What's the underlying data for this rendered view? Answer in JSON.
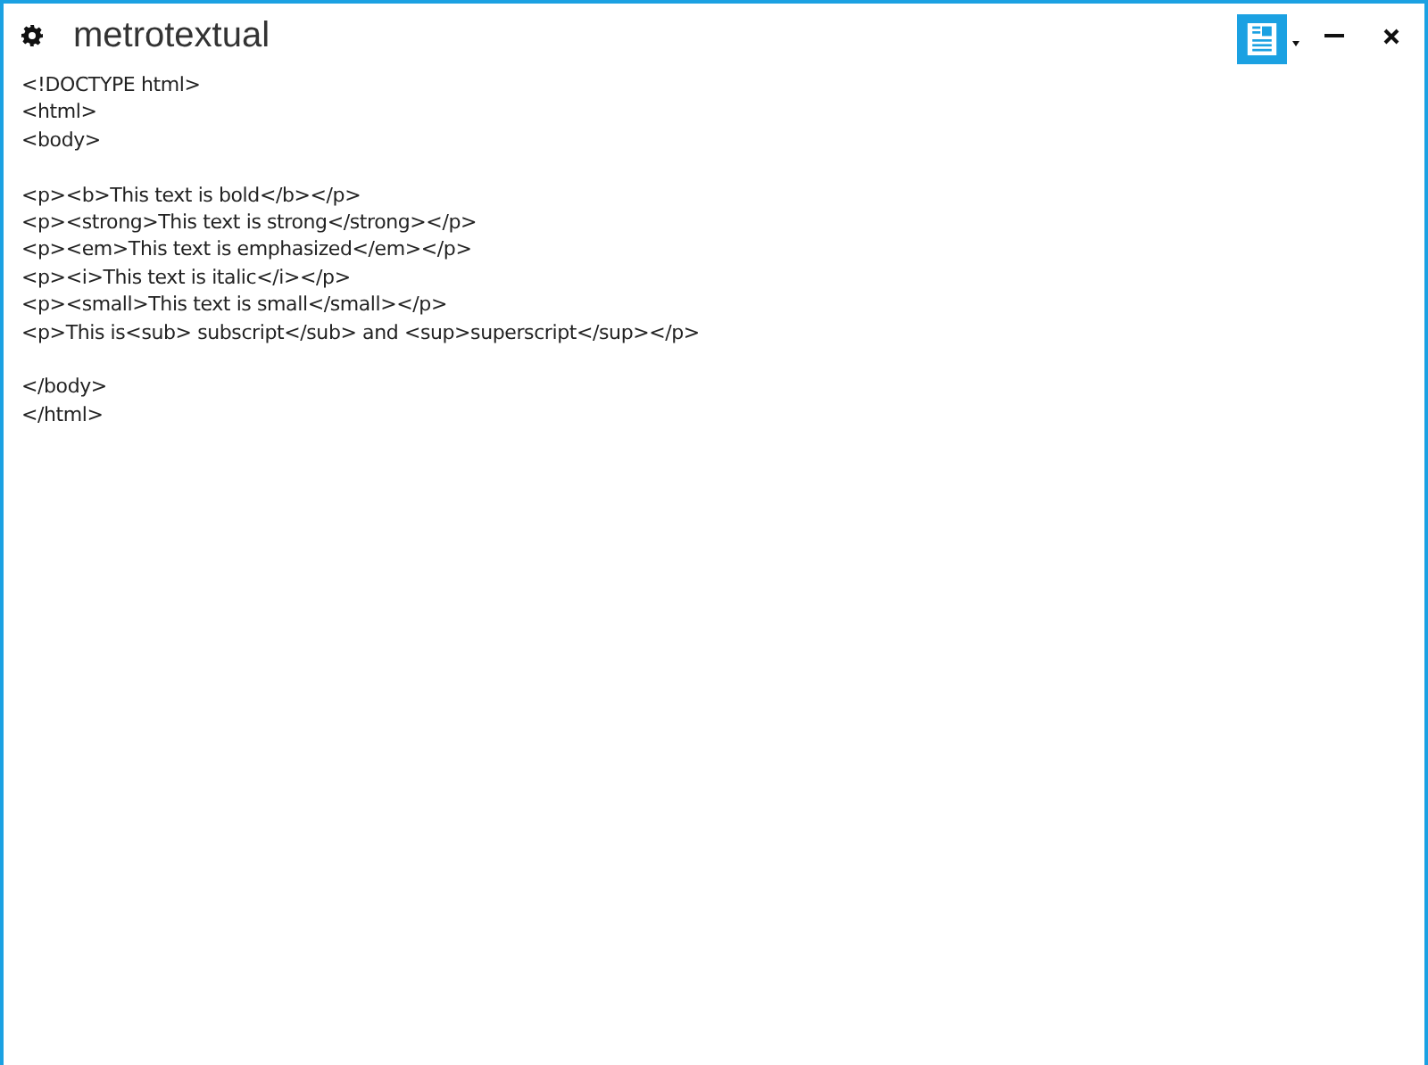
{
  "window": {
    "title": "metrotextual"
  },
  "editor": {
    "text": "<!DOCTYPE html>\n<html>\n<body>\n\n<p><b>This text is bold</b></p>\n<p><strong>This text is strong</strong></p>\n<p><em>This text is emphasized</em></p>\n<p><i>This text is italic</i></p>\n<p><small>This text is small</small></p>\n<p>This is<sub> subscript</sub> and <sup>superscript</sup></p>\n\n</body>\n</html>"
  }
}
